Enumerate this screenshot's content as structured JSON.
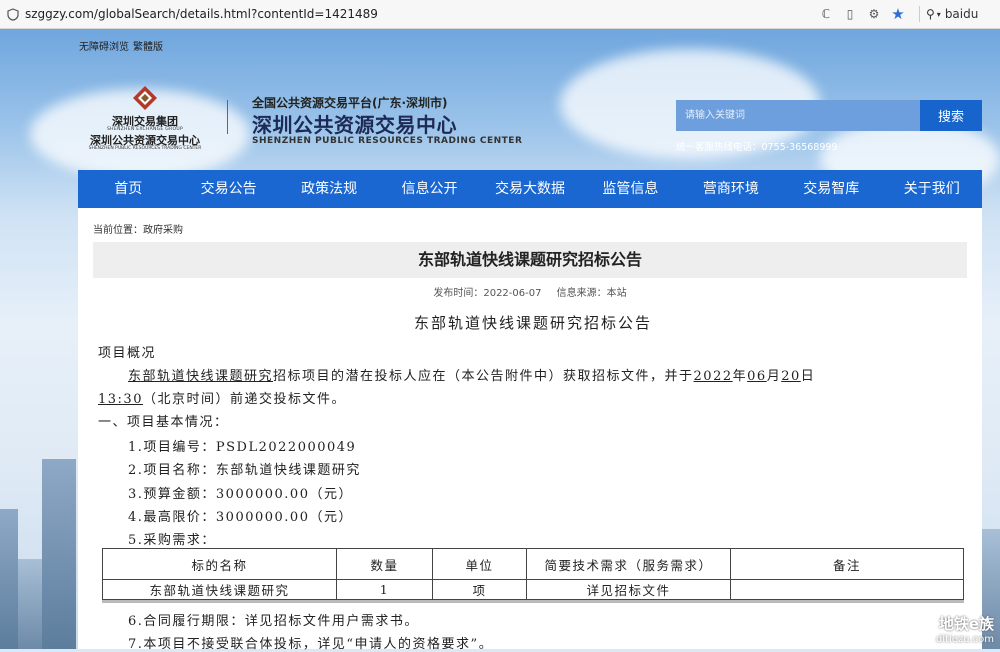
{
  "browser": {
    "url": "szggzy.com/globalSearch/details.html?contentId=1421489",
    "search_engine": "baidu",
    "icons": [
      "shield-icon",
      "read-aloud-icon",
      "reader-view-icon",
      "translate-icon",
      "favorite-star-icon",
      "search-icon"
    ]
  },
  "topbar": {
    "accessibility": "无障碍浏览",
    "traditional": "繁體版"
  },
  "header": {
    "group_cn": "深圳交易集团",
    "group_en": "SHENZHEN EXCHANGE GROUP",
    "center_cn": "深圳公共资源交易中心",
    "center_en": "SHENZHEN PUBLIC RESOURCES TRADING CENTER",
    "platform_sub": "全国公共资源交易平台(广东·深圳市)",
    "platform_title": "深圳公共资源交易中心",
    "platform_en": "SHENZHEN PUBLIC RESOURCES TRADING CENTER"
  },
  "search": {
    "placeholder": "请输入关键词",
    "button": "搜索",
    "hotline": "统一客服热线电话：0755-36568999"
  },
  "nav": [
    "首页",
    "交易公告",
    "政策法规",
    "信息公开",
    "交易大数据",
    "监管信息",
    "营商环境",
    "交易智库",
    "关于我们"
  ],
  "breadcrumb": "当前位置：政府采购",
  "article": {
    "title": "东部轨道快线课题研究招标公告",
    "publish_time": "发布时间：2022-06-07",
    "source": "信息来源：本站",
    "doc_title": "东部轨道快线课题研究招标公告",
    "overview": "项目概况",
    "para1_project": "东部轨道快线课题研究",
    "para1_mid": "招标项目的潜在投标人应在（本公告附件中）获取招标文件，并于",
    "year": "2022",
    "nian": "年",
    "month": "06",
    "yue": "月",
    "day": "20",
    "ri": "日",
    "time": "13:30",
    "para1_end": "（北京时间）前递交投标文件。",
    "section1": "一、项目基本情况：",
    "item1": "1.项目编号：PSDL2022000049",
    "item2": "2.项目名称：东部轨道快线课题研究",
    "item3": "3.预算金额：3000000.00（元）",
    "item4": "4.最高限价：3000000.00（元）",
    "item5": "5.采购需求：",
    "item6": "6.合同履行期限：详见招标文件用户需求书。",
    "item7": "7.本项目不接受联合体投标，详见“申请人的资格要求”。"
  },
  "table": {
    "headers": [
      "标的名称",
      "数量",
      "单位",
      "简要技术需求（服务需求）",
      "备注"
    ],
    "rows": [
      [
        "东部轨道快线课题研究",
        "1",
        "项",
        "详见招标文件",
        ""
      ]
    ]
  },
  "watermark": {
    "cn": "地铁e族",
    "en": "ditiezu.com"
  },
  "colors": {
    "nav_blue": "#1a67d2",
    "search_button": "#1765cc",
    "accent_dark": "#1c2a55"
  }
}
